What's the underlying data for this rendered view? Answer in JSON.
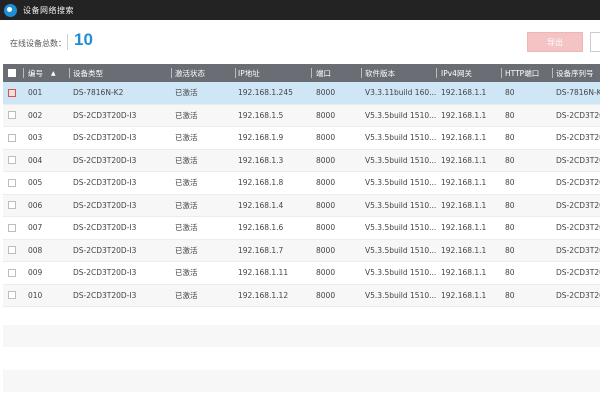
{
  "window": {
    "title": "设备网络搜索",
    "logo_icon": "app-logo-icon"
  },
  "summary": {
    "online_label": "在线设备总数：",
    "online_count": "10",
    "export_label": "导出",
    "export_color": "#f4c4c4",
    "accent_color": "#1e8fd6"
  },
  "table": {
    "header_color": "#6a6e74",
    "selected_row_color": "#cfe6f6",
    "columns": {
      "no": "编号",
      "type": "设备类型",
      "status": "激活状态",
      "ip": "IP地址",
      "port": "端口",
      "version": "软件版本",
      "gateway": "IPv4网关",
      "http_port": "HTTP端口",
      "serial": "设备序列号"
    },
    "rows": [
      {
        "no": "001",
        "type": "DS-7816N-K2",
        "status": "已激活",
        "ip": "192.168.1.245",
        "port": "8000",
        "version": "V3.3.11build 160...",
        "gateway": "192.168.1.1",
        "http_port": "80",
        "serial": "DS-7816N-K",
        "checked": true,
        "selected": true
      },
      {
        "no": "002",
        "type": "DS-2CD3T20D-I3",
        "status": "已激活",
        "ip": "192.168.1.5",
        "port": "8000",
        "version": "V5.3.5build 1510...",
        "gateway": "192.168.1.1",
        "http_port": "80",
        "serial": "DS-2CD3T20"
      },
      {
        "no": "003",
        "type": "DS-2CD3T20D-I3",
        "status": "已激活",
        "ip": "192.168.1.9",
        "port": "8000",
        "version": "V5.3.5build 1510...",
        "gateway": "192.168.1.1",
        "http_port": "80",
        "serial": "DS-2CD3T20"
      },
      {
        "no": "004",
        "type": "DS-2CD3T20D-I3",
        "status": "已激活",
        "ip": "192.168.1.3",
        "port": "8000",
        "version": "V5.3.5build 1510...",
        "gateway": "192.168.1.1",
        "http_port": "80",
        "serial": "DS-2CD3T20"
      },
      {
        "no": "005",
        "type": "DS-2CD3T20D-I3",
        "status": "已激活",
        "ip": "192.168.1.8",
        "port": "8000",
        "version": "V5.3.5build 1510...",
        "gateway": "192.168.1.1",
        "http_port": "80",
        "serial": "DS-2CD3T20"
      },
      {
        "no": "006",
        "type": "DS-2CD3T20D-I3",
        "status": "已激活",
        "ip": "192.168.1.4",
        "port": "8000",
        "version": "V5.3.5build 1510...",
        "gateway": "192.168.1.1",
        "http_port": "80",
        "serial": "DS-2CD3T20"
      },
      {
        "no": "007",
        "type": "DS-2CD3T20D-I3",
        "status": "已激活",
        "ip": "192.168.1.6",
        "port": "8000",
        "version": "V5.3.5build 1510...",
        "gateway": "192.168.1.1",
        "http_port": "80",
        "serial": "DS-2CD3T20"
      },
      {
        "no": "008",
        "type": "DS-2CD3T20D-I3",
        "status": "已激活",
        "ip": "192.168.1.7",
        "port": "8000",
        "version": "V5.3.5build 1510...",
        "gateway": "192.168.1.1",
        "http_port": "80",
        "serial": "DS-2CD3T20"
      },
      {
        "no": "009",
        "type": "DS-2CD3T20D-I3",
        "status": "已激活",
        "ip": "192.168.1.11",
        "port": "8000",
        "version": "V5.3.5build 1510...",
        "gateway": "192.168.1.1",
        "http_port": "80",
        "serial": "DS-2CD3T20"
      },
      {
        "no": "010",
        "type": "DS-2CD3T20D-I3",
        "status": "已激活",
        "ip": "192.168.1.12",
        "port": "8000",
        "version": "V5.3.5build 1510...",
        "gateway": "192.168.1.1",
        "http_port": "80",
        "serial": "DS-2CD3T20"
      }
    ]
  }
}
